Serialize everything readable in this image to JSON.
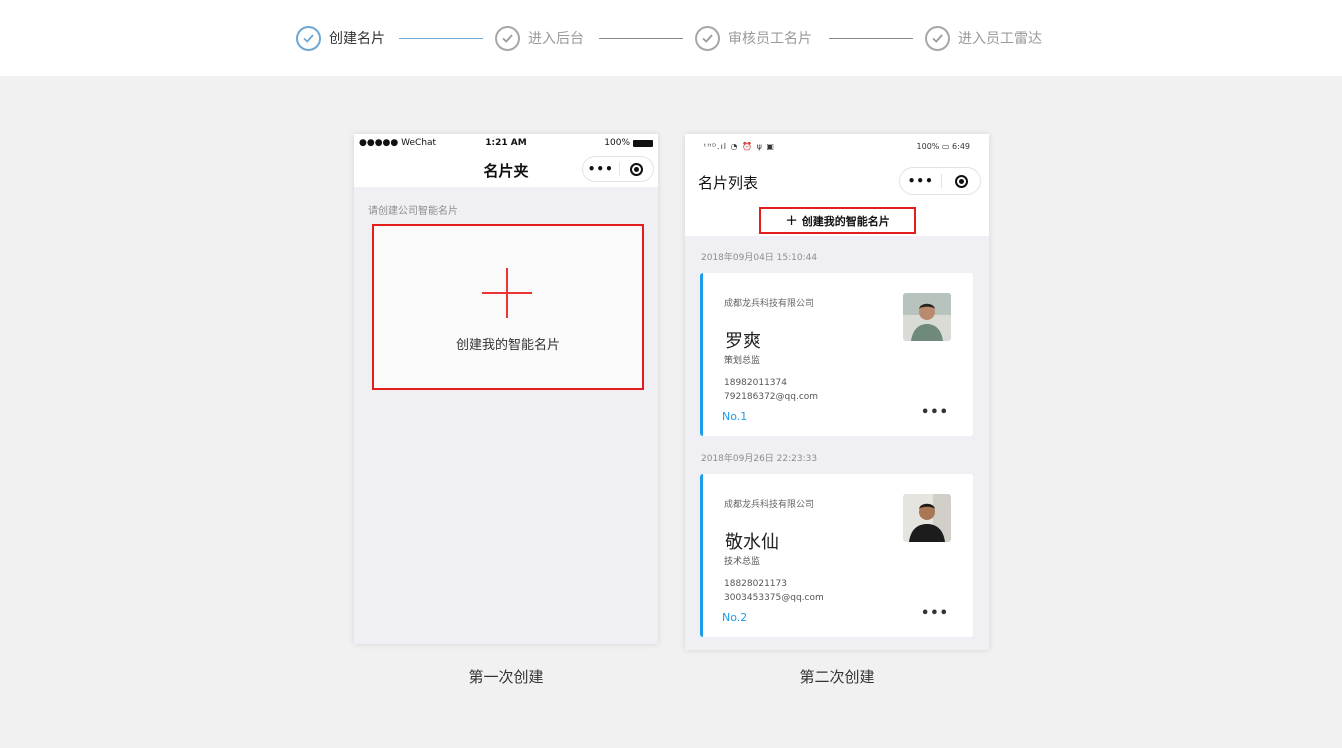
{
  "steps": [
    {
      "label": "创建名片",
      "state": "active"
    },
    {
      "label": "进入后台",
      "state": "inactive"
    },
    {
      "label": "审核员工名片",
      "state": "inactive"
    },
    {
      "label": "进入员工雷达",
      "state": "inactive"
    }
  ],
  "phone1": {
    "status": {
      "carrier": "●●●●● WeChat",
      "time": "1:21 AM",
      "battery": "100%"
    },
    "nav_title": "名片夹",
    "hint": "请创建公司智能名片",
    "create_label": "创建我的智能名片"
  },
  "phone2": {
    "status": {
      "icons": "ᵗᴴᴰ.ıl ◔ ⏰ ψ ▣",
      "right": "100% ▭ 6:49"
    },
    "title": "名片列表",
    "create_label": "创建我的智能名片",
    "cards": [
      {
        "date": "2018年09月04日 15:10:44",
        "company": "成都龙兵科技有限公司",
        "name": "罗爽",
        "role": "策划总监",
        "phone": "18982011374",
        "email": "792186372@qq.com",
        "no": "No.1"
      },
      {
        "date": "2018年09月26日 22:23:33",
        "company": "成都龙兵科技有限公司",
        "name": "敬水仙",
        "role": "技术总监",
        "phone": "18828021173",
        "email": "3003453375@qq.com",
        "no": "No.2"
      }
    ]
  },
  "captions": {
    "first": "第一次创建",
    "second": "第二次创建"
  },
  "colors": {
    "accent": "#1e9be9",
    "step_active": "#6fa7d3",
    "highlight": "#e41d1d"
  }
}
